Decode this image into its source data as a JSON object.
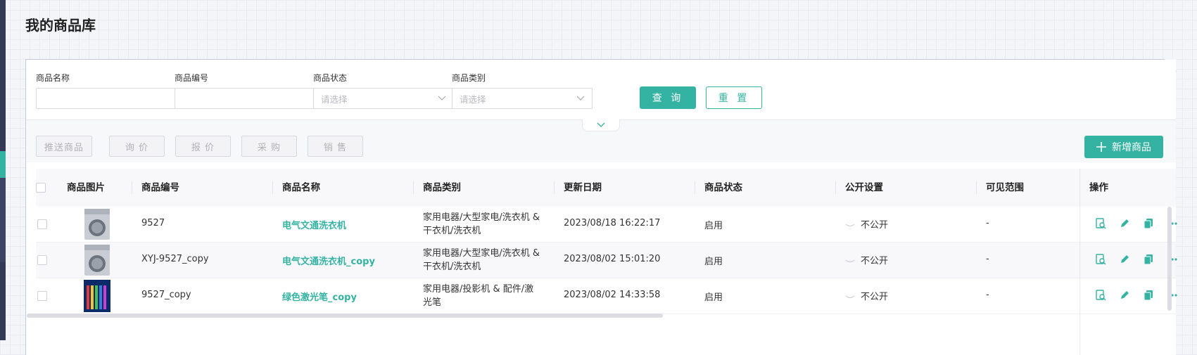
{
  "page": {
    "title": "我的商品库"
  },
  "filters": {
    "name": {
      "label": "商品名称",
      "value": "",
      "placeholder": ""
    },
    "code": {
      "label": "商品编号",
      "value": "",
      "placeholder": ""
    },
    "status": {
      "label": "商品状态",
      "placeholder": "请选择"
    },
    "category": {
      "label": "商品类别",
      "placeholder": "请选择"
    },
    "query_label": "查 询",
    "reset_label": "重 置"
  },
  "toolbar": {
    "push_label": "推送商品",
    "inquiry_label": "询 价",
    "quote_label": "报 价",
    "purchase_label": "采 购",
    "sales_label": "销 售",
    "add_label": "新增商品"
  },
  "table": {
    "columns": {
      "image": "商品图片",
      "code": "商品编号",
      "name": "商品名称",
      "category": "商品类别",
      "updated": "更新日期",
      "status": "商品状态",
      "public": "公开设置",
      "visible": "可见范围",
      "actions": "操作"
    },
    "rows": [
      {
        "image": "washing-machine",
        "code": "9527",
        "name": "电气文通洗衣机",
        "category": "家用电器/大型家电/洗衣机 & 干衣机/洗衣机",
        "updated": "2023/08/18 16:22:17",
        "status": "启用",
        "public": "不公开",
        "visible": "-"
      },
      {
        "image": "washing-machine",
        "code": "XYJ-9527_copy",
        "name": "电气文通洗衣机_copy",
        "category": "家用电器/大型家电/洗衣机 & 干衣机/洗衣机",
        "updated": "2023/08/02 15:01:20",
        "status": "启用",
        "public": "不公开",
        "visible": "-"
      },
      {
        "image": "laser-pens",
        "code": "9527_copy",
        "name": "绿色激光笔_copy",
        "category": "家用电器/投影机 & 配件/激光笔",
        "updated": "2023/08/02 14:33:58",
        "status": "启用",
        "public": "不公开",
        "visible": "-"
      }
    ]
  },
  "colors": {
    "accent": "#35b3a2",
    "sidebar": "#343a55"
  },
  "icons": [
    "chevron-down-icon",
    "plus-icon",
    "preview-icon",
    "edit-icon",
    "copy-icon",
    "more-icon",
    "eye-closed-icon"
  ]
}
